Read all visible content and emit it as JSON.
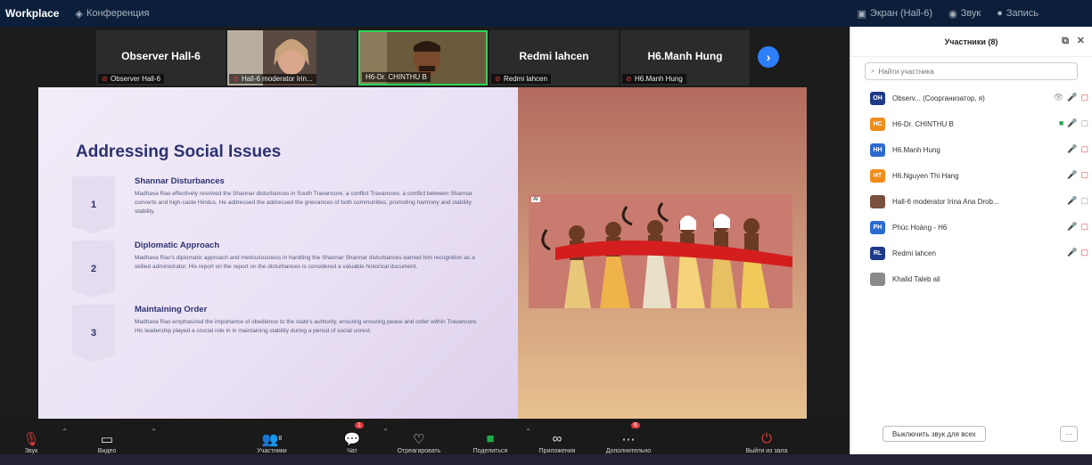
{
  "titlebar": {
    "app": "Workplace",
    "items": [
      "Конференция",
      "Экран (Hall-6)",
      "Звук",
      "Запись"
    ]
  },
  "thumbnails": [
    {
      "name": "Observer  Hall-6",
      "tag": "Observer  Hall-6",
      "video": false
    },
    {
      "name": "",
      "tag": "Hall-6 moderator Irin...",
      "video": true
    },
    {
      "name": "",
      "tag": "H6-Dr. CHINTHU B",
      "video": true,
      "active": true
    },
    {
      "name": "Redmi lahcen",
      "tag": "Redmi lahcen",
      "video": false
    },
    {
      "name": "H6.Manh Hung",
      "tag": "H6.Manh Hung",
      "video": false
    }
  ],
  "slide": {
    "title": "Addressing Social Issues",
    "steps": [
      {
        "num": "1",
        "heading": "Shannar Disturbances",
        "body": "Madhava Rao effectively resolved the Shannar disturbances in South Travancore, a conflict Travancore, a conflict between Shannar converts and high-caste Hindus. He addressed the addressed the grievances of both communities, promoting harmony and stability stability."
      },
      {
        "num": "2",
        "heading": "Diplomatic Approach",
        "body": "Madhava Rao's diplomatic approach and meticulousness in handling the Shannar Shannar disturbances earned him recognition as a skilled administrator. His report on the report on the disturbances is considered a valuable historical document."
      },
      {
        "num": "3",
        "heading": "Maintaining Order",
        "body": "Madhava Rao emphasized the importance of obedience to the state's authority, ensuring ensuring peace and order within Travancore. His leadership played a crucial role in in maintaining stability during a period of social unrest."
      }
    ],
    "image_badge": "AI"
  },
  "toolbar": {
    "items": [
      {
        "label": "Звук",
        "icon": "mic-muted-icon",
        "glyph": "🎙",
        "caret": true
      },
      {
        "label": "Видео",
        "icon": "camera-icon",
        "glyph": "▭",
        "caret": true
      },
      {
        "label": "Участники",
        "icon": "participants-icon",
        "glyph": "👥",
        "count": "8",
        "caret": true
      },
      {
        "label": "Чат",
        "icon": "chat-icon",
        "glyph": "💬",
        "badge": "1",
        "caret": true
      },
      {
        "label": "Отреагировать",
        "icon": "reaction-icon",
        "glyph": "♡"
      },
      {
        "label": "Поделиться",
        "icon": "share-screen-icon",
        "glyph": "■",
        "caret": true
      },
      {
        "label": "Приложения",
        "icon": "apps-icon",
        "glyph": "⌘"
      },
      {
        "label": "Дополнительно",
        "icon": "more-icon",
        "glyph": "⋯",
        "badge": "6"
      },
      {
        "label": "Выйти из зала",
        "icon": "leave-icon",
        "glyph": "⏻"
      }
    ]
  },
  "panel": {
    "title": "Участники (8)",
    "search_placeholder": "Найти участника",
    "participants": [
      {
        "initials": "OH",
        "name": "Observ...  (Соорганизатор, я)",
        "color": "#1e3a8a",
        "icons": [
          "grey:👁",
          "red:🎤",
          "red:▢"
        ]
      },
      {
        "initials": "HC",
        "name": "H6-Dr. CHINTHU B",
        "color": "#f08c1a",
        "icons": [
          "green:■",
          "blue:🎤",
          "grey:▢"
        ]
      },
      {
        "initials": "HH",
        "name": "H6.Manh Hung",
        "color": "#2d6bd1",
        "icons": [
          "red:🎤",
          "red:▢"
        ]
      },
      {
        "initials": "HT",
        "name": "H6.Nguyen Thi Hang",
        "color": "#f08c1a",
        "icons": [
          "red:🎤",
          "red:▢"
        ]
      },
      {
        "initials": "",
        "name": "Hall-6 moderator Irina Ana Drob...",
        "color": "#7a5040",
        "photo": true,
        "icons": [
          "red:🎤",
          "grey:▢"
        ]
      },
      {
        "initials": "PH",
        "name": "Phúc Hoàng - H6",
        "color": "#2d6bd1",
        "icons": [
          "red:🎤",
          "red:▢"
        ]
      },
      {
        "initials": "RL",
        "name": "Redmi lahcen",
        "color": "#1e3a8a",
        "icons": [
          "red:🎤",
          "red:▢"
        ]
      },
      {
        "initials": "",
        "name": "Khalid Taleb ali",
        "color": "#8a8a8a",
        "photo": true,
        "icons": []
      }
    ],
    "mute_all": "Выключить звук для всех",
    "more": "···"
  }
}
